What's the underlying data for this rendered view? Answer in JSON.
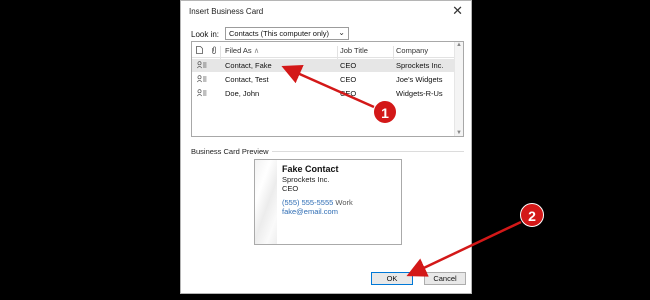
{
  "dialog": {
    "title": "Insert Business Card",
    "close_glyph": "✕",
    "lookin_label": "Look in:",
    "lookin_value": "Contacts (This computer only)"
  },
  "list": {
    "columns": [
      "Filed As",
      "Job Title",
      "Company"
    ],
    "rows": [
      {
        "filed_as": "Contact, Fake",
        "job_title": "CEO",
        "company": "Sprockets Inc.",
        "selected": true
      },
      {
        "filed_as": "Contact, Test",
        "job_title": "CEO",
        "company": "Joe's Widgets",
        "selected": false
      },
      {
        "filed_as": "Doe, John",
        "job_title": "CEO",
        "company": "Widgets-R-Us",
        "selected": false
      }
    ]
  },
  "preview": {
    "label": "Business Card Preview",
    "name": "Fake Contact",
    "company": "Sprockets Inc.",
    "title": "CEO",
    "phone": "(555) 555-5555",
    "phone_type": "Work",
    "email": "fake@email.com"
  },
  "buttons": {
    "ok": "OK",
    "cancel": "Cancel"
  },
  "annotations": {
    "callout1": "1",
    "callout2": "2",
    "color": "#d31818"
  },
  "colors": {
    "selection": "#e6e6e6",
    "link": "#2d6cb4",
    "ok_border": "#0078d7"
  }
}
